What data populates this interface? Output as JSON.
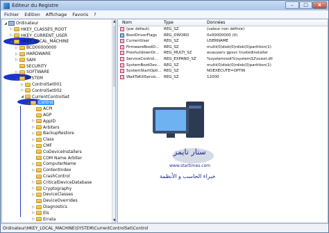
{
  "window": {
    "title": "Éditeur du Registre",
    "controls": {
      "min": "–",
      "max": "□",
      "close": "x"
    }
  },
  "menu": [
    "Fichier",
    "Edition",
    "Affichage",
    "Favoris",
    "?"
  ],
  "tree": [
    {
      "label": "Ordinateur",
      "level": 0,
      "exp": "◢",
      "icon": "computer"
    },
    {
      "label": "HKEY_CLASSES_ROOT",
      "level": 1,
      "exp": "▷",
      "icon": "folder"
    },
    {
      "label": "HKEY_CURRENT_USER",
      "level": 1,
      "exp": "▷",
      "icon": "folder"
    },
    {
      "label": "HKEY_LOCAL_MACHINE",
      "level": 1,
      "exp": "◢",
      "icon": "folder"
    },
    {
      "label": "BCD00000000",
      "level": 2,
      "exp": "▷",
      "icon": "folder"
    },
    {
      "label": "HARDWARE",
      "level": 2,
      "exp": "▷",
      "icon": "folder"
    },
    {
      "label": "SAM",
      "level": 2,
      "exp": "▷",
      "icon": "folder"
    },
    {
      "label": "SECURITY",
      "level": 2,
      "exp": "",
      "icon": "folder"
    },
    {
      "label": "SOFTWARE",
      "level": 2,
      "exp": "▷",
      "icon": "folder"
    },
    {
      "label": "SYSTEM",
      "level": 2,
      "exp": "◢",
      "icon": "folder"
    },
    {
      "label": "ControlSet001",
      "level": 3,
      "exp": "▷",
      "icon": "folder"
    },
    {
      "label": "ControlSet002",
      "level": 3,
      "exp": "▷",
      "icon": "folder"
    },
    {
      "label": "CurrentControlSet",
      "level": 3,
      "exp": "◢",
      "icon": "folder"
    },
    {
      "label": "Control",
      "level": 4,
      "exp": "◢",
      "icon": "folder",
      "selected": true
    },
    {
      "label": "ACPI",
      "level": 5,
      "exp": "",
      "icon": "folder"
    },
    {
      "label": "AGP",
      "level": 5,
      "exp": "",
      "icon": "folder"
    },
    {
      "label": "AppID",
      "level": 5,
      "exp": "▷",
      "icon": "folder"
    },
    {
      "label": "Arbiters",
      "level": 5,
      "exp": "▷",
      "icon": "folder"
    },
    {
      "label": "BackupRestore",
      "level": 5,
      "exp": "▷",
      "icon": "folder"
    },
    {
      "label": "Class",
      "level": 5,
      "exp": "▷",
      "icon": "folder"
    },
    {
      "label": "CMF",
      "level": 5,
      "exp": "▷",
      "icon": "folder"
    },
    {
      "label": "CoDeviceInstallers",
      "level": 5,
      "exp": "",
      "icon": "folder"
    },
    {
      "label": "COM Name Arbiter",
      "level": 5,
      "exp": "",
      "icon": "folder"
    },
    {
      "label": "ComputerName",
      "level": 5,
      "exp": "▷",
      "icon": "folder"
    },
    {
      "label": "ContentIndex",
      "level": 5,
      "exp": "▷",
      "icon": "folder"
    },
    {
      "label": "CrashControl",
      "level": 5,
      "exp": "",
      "icon": "folder"
    },
    {
      "label": "CriticalDeviceDatabase",
      "level": 5,
      "exp": "▷",
      "icon": "folder"
    },
    {
      "label": "Cryptography",
      "level": 5,
      "exp": "▷",
      "icon": "folder"
    },
    {
      "label": "DeviceClasses",
      "level": 5,
      "exp": "▷",
      "icon": "folder"
    },
    {
      "label": "DeviceOverrides",
      "level": 5,
      "exp": "",
      "icon": "folder"
    },
    {
      "label": "Diagnostics",
      "level": 5,
      "exp": "▷",
      "icon": "folder"
    },
    {
      "label": "Els",
      "level": 5,
      "exp": "▷",
      "icon": "folder"
    },
    {
      "label": "Errata",
      "level": 5,
      "exp": "▷",
      "icon": "folder"
    }
  ],
  "columns": {
    "name": "Nom",
    "type": "Type",
    "data": "Données"
  },
  "rows": [
    {
      "name": "(par défaut)",
      "type": "REG_SZ",
      "data": "(valeur non définie)",
      "kind": "sz"
    },
    {
      "name": "BootDriverFlags",
      "type": "REG_DWORD",
      "data": "0x00000000 (0)",
      "kind": "dw"
    },
    {
      "name": "CurrentUser",
      "type": "REG_SZ",
      "data": "USERNAME",
      "kind": "sz"
    },
    {
      "name": "FirmwareBootD...",
      "type": "REG_SZ",
      "data": "multi(0)disk(0)rdisk(0)partition(1)",
      "kind": "sz"
    },
    {
      "name": "PreshutdownOr...",
      "type": "REG_MULTI_SZ",
      "data": "wuauserv gpsvc trustedinstaller",
      "kind": "sz"
    },
    {
      "name": "ServiceControl...",
      "type": "REG_EXPAND_SZ",
      "data": "%systemroot%\\system32\\scext.dll",
      "kind": "sz"
    },
    {
      "name": "SystemBootDev...",
      "type": "REG_SZ",
      "data": "multi(0)disk(0)rdisk(0)partition(1)",
      "kind": "sz"
    },
    {
      "name": "SystemStartOpti...",
      "type": "REG_SZ",
      "data": "NOEXECUTE=OPTIN",
      "kind": "sz"
    },
    {
      "name": "WaitToKillServic...",
      "type": "REG_SZ",
      "data": "12000",
      "kind": "sz"
    }
  ],
  "watermark": {
    "site": "www.startimes.com",
    "arabic_top": "ستار تايمز",
    "arabic_bottom": "خبراء الحاسب و الأنظمة"
  },
  "status": "Ordinateur\\HKEY_LOCAL_MACHINE\\SYSTEM\\CurrentControlSet\\Control"
}
